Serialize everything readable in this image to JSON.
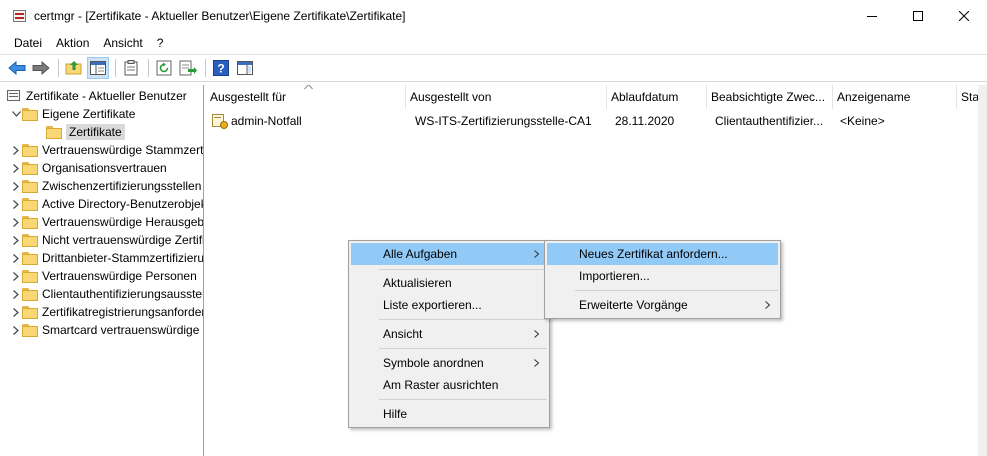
{
  "window": {
    "title": "certmgr - [Zertifikate - Aktueller Benutzer\\Eigene Zertifikate\\Zertifikate]"
  },
  "menubar": [
    "Datei",
    "Aktion",
    "Ansicht",
    "?"
  ],
  "toolbar": {
    "icons": [
      "back-arrow-icon",
      "forward-arrow-icon",
      "up-folder-icon",
      "show-tree-icon",
      "properties-icon",
      "refresh-icon",
      "export-list-icon",
      "help-icon",
      "show-action-pane-icon"
    ]
  },
  "tree": {
    "root": "Zertifikate - Aktueller Benutzer",
    "expanded": "Eigene Zertifikate",
    "selected": "Zertifikate",
    "items": [
      "Vertrauenswürdige Stammzertifizierungsstellen",
      "Organisationsvertrauen",
      "Zwischenzertifizierungsstellen",
      "Active Directory-Benutzerobjekt",
      "Vertrauenswürdige Herausgeber",
      "Nicht vertrauenswürdige Zertifikate",
      "Drittanbieter-Stammzertifizierungsstellen",
      "Vertrauenswürdige Personen",
      "Clientauthentifizierungsaussteller",
      "Zertifikatregistrierungsanforderungen",
      "Smartcard vertrauenswürdige Stämme"
    ]
  },
  "list": {
    "columns": [
      "Ausgestellt für",
      "Ausgestellt von",
      "Ablaufdatum",
      "Beabsichtigte Zwec...",
      "Anzeigename",
      "Sta"
    ],
    "rows": [
      {
        "issued_to": "admin-Notfall",
        "issued_by": "WS-ITS-Zertifizierungsstelle-CA1",
        "expires": "28.11.2020",
        "purpose": "Clientauthentifizier...",
        "friendly_name": "<Keine>"
      }
    ]
  },
  "context_menu": {
    "items": [
      "Alle Aufgaben",
      "Aktualisieren",
      "Liste exportieren...",
      "Ansicht",
      "Symbole anordnen",
      "Am Raster ausrichten",
      "Hilfe"
    ],
    "highlighted": "Alle Aufgaben"
  },
  "submenu": {
    "items": [
      "Neues Zertifikat anfordern...",
      "Importieren...",
      "Erweiterte Vorgänge"
    ],
    "highlighted": "Neues Zertifikat anfordern..."
  },
  "colors": {
    "menu_highlight": "#91c9f7",
    "menu_background": "#f0f0f0",
    "folder": "#f8d775"
  }
}
